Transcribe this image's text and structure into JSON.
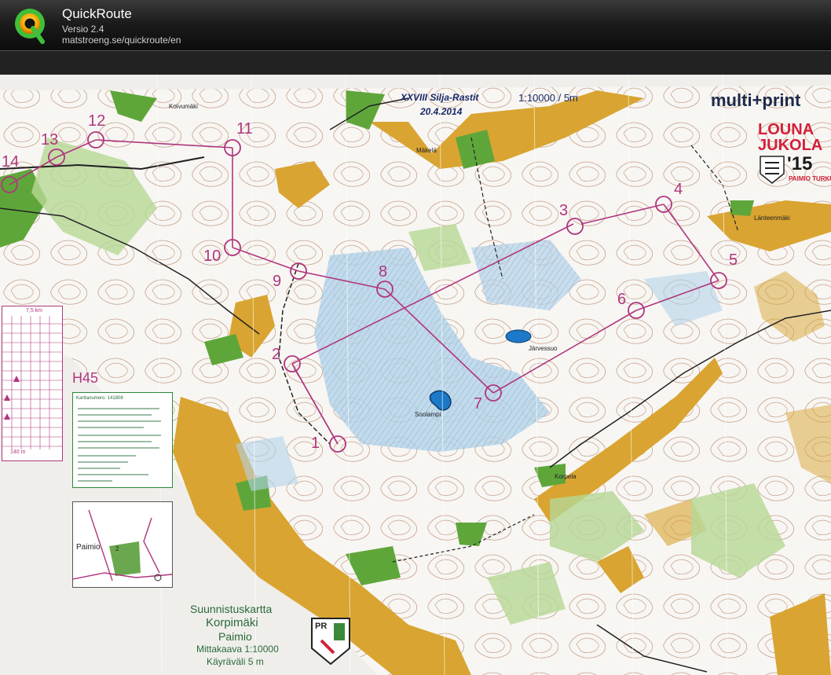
{
  "app": {
    "title": "QuickRoute",
    "version": "Versio 2.4",
    "url": "matstroeng.se/quickroute/en"
  },
  "map": {
    "event": "XXVIII Silja-Rastit",
    "date": "20.4.2014",
    "scale_header": "1:10000 / 5m",
    "sponsor": "multi+print",
    "jukola_line1": "LOUNA",
    "jukola_line2": "JUKOLA",
    "jukola_year": "'15",
    "jukola_city": "PAIMIO TURKU",
    "class_name": "H45",
    "controls": [
      "1",
      "2",
      "3",
      "4",
      "5",
      "6",
      "7",
      "8",
      "9",
      "10",
      "11",
      "12",
      "13",
      "14"
    ],
    "place_names": {
      "koivumaki": "Koivumäki",
      "makela": "Mäkelä",
      "lanteenmaki": "Länteenmäki",
      "jarvessuo": "Järvessuo",
      "soolampi": "Soolampi",
      "korpela": "Korpela",
      "paimio_inset": "Paimio"
    },
    "map_title": "Suunnistuskartta",
    "map_name": "Korpimäki",
    "map_town": "Paimio",
    "map_scale": "Mittakaava 1:10000",
    "map_contour": "Käyräväli 5 m",
    "club_logo": "PR",
    "legend_top": "7,5 km",
    "legend_bottom": "140 m",
    "info_text": "Karttanumero: 141808"
  }
}
